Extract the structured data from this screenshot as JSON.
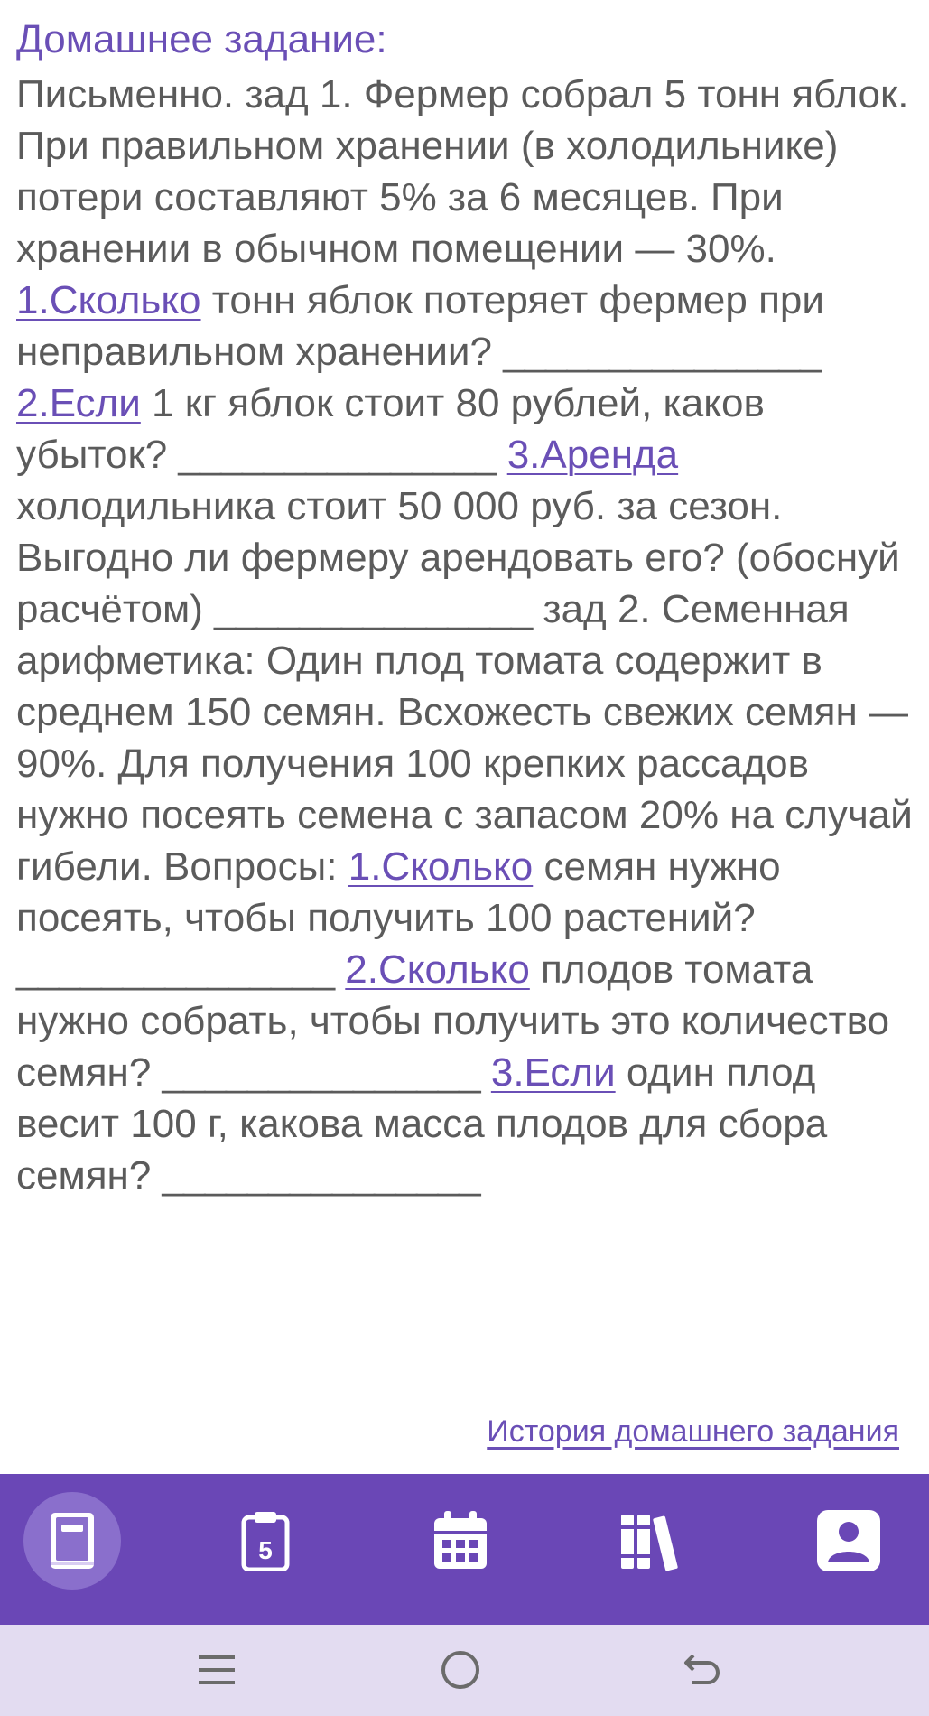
{
  "homework": {
    "title": "Домашнее задание:",
    "segments": [
      {
        "t": "Письменно. зад 1. Фермер собрал 5 тонн яблок. При правильном хранении (в холодильнике) потери составляют 5% за 6 месяцев. При хранении в обычном помещении — 30%. "
      },
      {
        "t": "1.Сколько",
        "link": true
      },
      {
        "t": " тонн яблок потеряет фермер при неправильном хранении? "
      },
      {
        "t": "_______________",
        "blank": true
      },
      {
        "t": " "
      },
      {
        "t": "2.Если",
        "link": true
      },
      {
        "t": " 1 кг яблок стоит 80 рублей, каков убыток? "
      },
      {
        "t": "_______________",
        "blank": true
      },
      {
        "t": " "
      },
      {
        "t": "3.Аренда",
        "link": true
      },
      {
        "t": " холодильника стоит 50 000 руб. за сезон. Выгодно ли фермеру арендовать его? (обоснуй расчётом) "
      },
      {
        "t": "_______________",
        "blank": true
      },
      {
        "t": " зад 2. Семенная арифметика: Один плод томата содержит в среднем 150 семян. Всхожесть свежих семян — 90%. Для получения 100 крепких рассадов нужно посеять семена с запасом 20% на случай гибели. Вопросы: "
      },
      {
        "t": "1.Сколько",
        "link": true
      },
      {
        "t": " семян нужно посеять, чтобы получить 100 растений? "
      },
      {
        "t": "_______________",
        "blank": true
      },
      {
        "t": " "
      },
      {
        "t": "2.Сколько",
        "link": true
      },
      {
        "t": " плодов томата нужно собрать, чтобы получить это количество семян? "
      },
      {
        "t": "_______________",
        "blank": true
      },
      {
        "t": " "
      },
      {
        "t": "3.Если",
        "link": true
      },
      {
        "t": " один плод весит 100 г, какова масса плодов для сбора семян? "
      },
      {
        "t": "_______________",
        "blank": true
      }
    ],
    "history_link": "История домашнего задания"
  },
  "nav": {
    "items": [
      {
        "icon": "book-icon",
        "active": true
      },
      {
        "icon": "grade-clipboard-icon",
        "active": false
      },
      {
        "icon": "calendar-icon",
        "active": false
      },
      {
        "icon": "library-icon",
        "active": false
      },
      {
        "icon": "profile-icon",
        "active": false
      }
    ]
  },
  "system_nav": {
    "items": [
      {
        "icon": "recent-apps-icon"
      },
      {
        "icon": "home-icon"
      },
      {
        "icon": "back-icon"
      }
    ]
  },
  "colors": {
    "accent": "#6a47b6",
    "text": "#5b5b5b",
    "nav_active": "#8a6fcc",
    "system_bar": "#e3dcf1"
  }
}
